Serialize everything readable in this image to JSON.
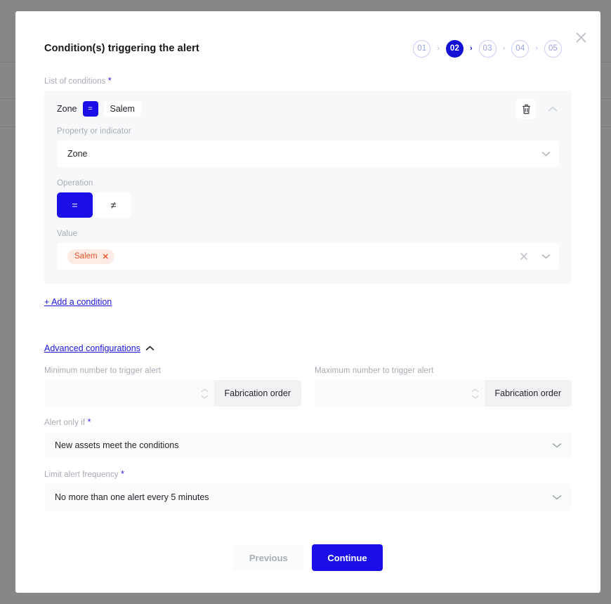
{
  "colors": {
    "accent_blue": "#1a0fe6",
    "step_active": "#1411d4",
    "link_blue": "#1b14e0",
    "tag_text": "#e2572a",
    "tag_bg": "#fdece6",
    "card_bg": "#f7f8f9"
  },
  "modal": {
    "title": "Condition(s) triggering the alert",
    "close_icon": "close-icon"
  },
  "stepper": {
    "steps": [
      {
        "label": "01",
        "active": false
      },
      {
        "label": "02",
        "active": true
      },
      {
        "label": "03",
        "active": false
      },
      {
        "label": "04",
        "active": false
      },
      {
        "label": "05",
        "active": false
      }
    ],
    "separator": "›"
  },
  "conditions": {
    "label": "List of conditions",
    "required": "*",
    "card": {
      "summary": {
        "property": "Zone",
        "operator": "=",
        "value": "Salem",
        "delete_icon": "trash-icon",
        "collapse_icon": "chevron-up-icon"
      },
      "property_field": {
        "label": "Property or indicator",
        "value": "Zone",
        "chevron_icon": "chevron-down-icon"
      },
      "operation_field": {
        "label": "Operation",
        "options": [
          {
            "label": "=",
            "selected": true
          },
          {
            "label": "≠",
            "selected": false
          }
        ]
      },
      "value_field": {
        "label": "Value",
        "tags": [
          {
            "label": "Salem",
            "remove_icon": "close-icon"
          }
        ],
        "clear_icon": "close-icon",
        "chevron_icon": "chevron-down-icon"
      }
    },
    "add_link": "+ Add a condition"
  },
  "advanced": {
    "toggle_label": "Advanced configurations",
    "toggle_icon": "chevron-up-icon",
    "min": {
      "label": "Minimum number to trigger alert",
      "value": "",
      "placeholder": "",
      "suffix": "Fabrication order",
      "stepper_up_icon": "chevron-up-icon",
      "stepper_down_icon": "chevron-down-icon"
    },
    "max": {
      "label": "Maximum number to trigger alert",
      "value": "",
      "placeholder": "",
      "suffix": "Fabrication order",
      "stepper_up_icon": "chevron-up-icon",
      "stepper_down_icon": "chevron-down-icon"
    },
    "alert_only_if": {
      "label": "Alert only if",
      "required": "*",
      "value": "New assets meet the conditions",
      "chevron_icon": "chevron-down-icon"
    },
    "limit_frequency": {
      "label": "Limit alert frequency",
      "required": "*",
      "value": "No more than one alert every 5 minutes",
      "chevron_icon": "chevron-down-icon"
    }
  },
  "footer": {
    "previous": "Previous",
    "continue": "Continue"
  }
}
